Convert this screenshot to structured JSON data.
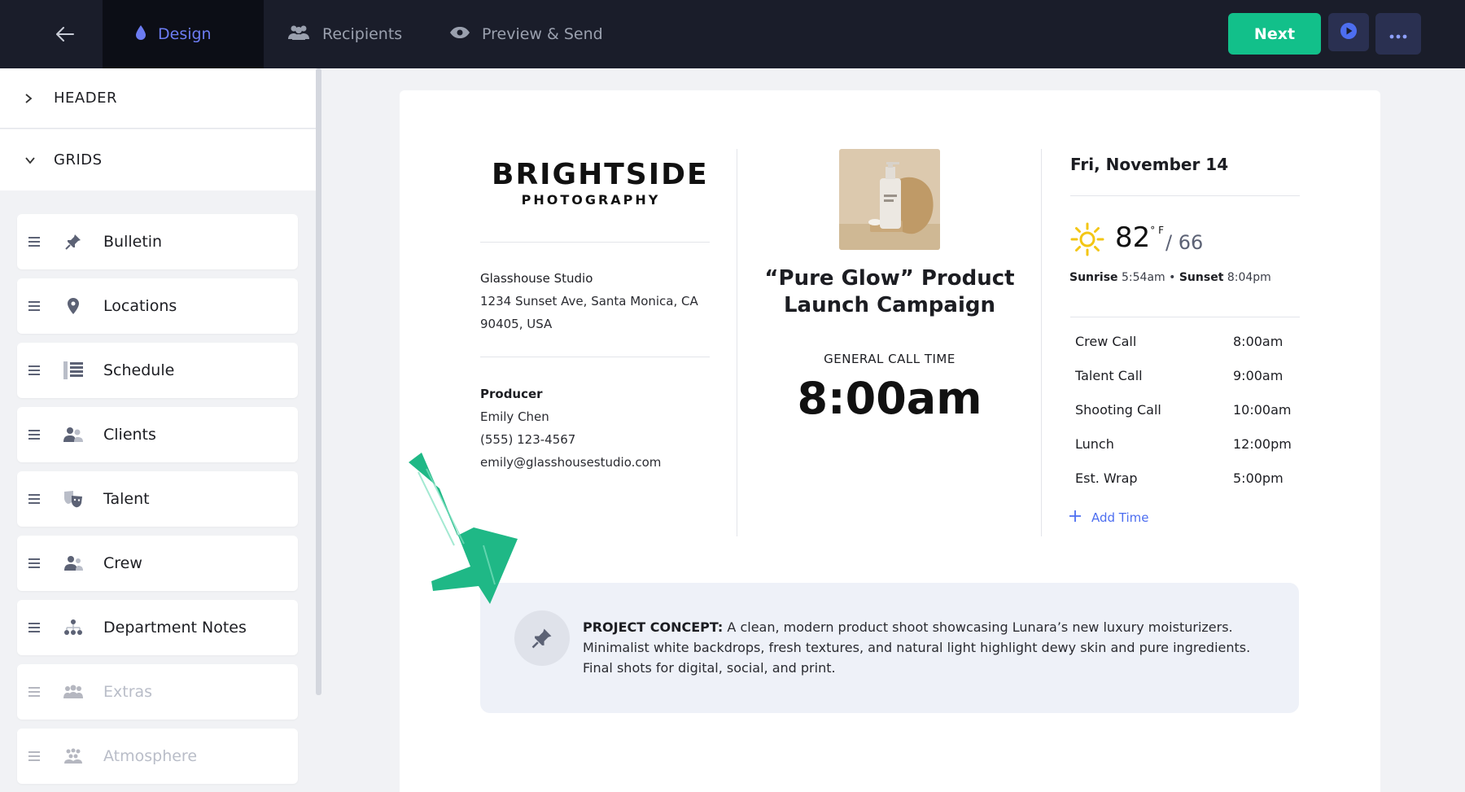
{
  "topbar": {
    "tabs": [
      {
        "label": "Design",
        "icon": "droplet-icon",
        "active": true
      },
      {
        "label": "Recipients",
        "icon": "people-icon",
        "active": false
      },
      {
        "label": "Preview & Send",
        "icon": "eye-icon",
        "active": false
      }
    ],
    "next_label": "Next"
  },
  "sidebar": {
    "header_label": "HEADER",
    "grids_label": "GRIDS",
    "items": [
      {
        "label": "Bulletin",
        "icon": "pin-icon",
        "enabled": true
      },
      {
        "label": "Locations",
        "icon": "map-pin-icon",
        "enabled": true
      },
      {
        "label": "Schedule",
        "icon": "list-icon",
        "enabled": true
      },
      {
        "label": "Clients",
        "icon": "clients-icon",
        "enabled": true
      },
      {
        "label": "Talent",
        "icon": "masks-icon",
        "enabled": true
      },
      {
        "label": "Crew",
        "icon": "crew-icon",
        "enabled": true
      },
      {
        "label": "Department Notes",
        "icon": "org-chart-icon",
        "enabled": true
      },
      {
        "label": "Extras",
        "icon": "group-icon",
        "enabled": false
      },
      {
        "label": "Atmosphere",
        "icon": "crowd-icon",
        "enabled": false
      }
    ]
  },
  "sheet": {
    "logo": {
      "main": "BRIGHTSIDE",
      "sub": "PHOTOGRAPHY"
    },
    "studio": {
      "name": "Glasshouse Studio",
      "address1": "1234 Sunset Ave, Santa Monica, CA",
      "address2": "90405, USA"
    },
    "producer": {
      "label": "Producer",
      "name": "Emily Chen",
      "phone": "(555) 123-4567",
      "email": "emily@glasshousestudio.com"
    },
    "title": "“Pure Glow” Product Launch Campaign",
    "general_call_label": "GENERAL CALL TIME",
    "general_call_time": "8:00am",
    "date": "Fri, November 14",
    "weather": {
      "high": "82",
      "unit": "° F",
      "low": "/ 66",
      "sunrise_label": "Sunrise",
      "sunrise": "5:54am",
      "separator": "•",
      "sunset_label": "Sunset",
      "sunset": "8:04pm"
    },
    "schedule": [
      {
        "label": "Crew Call",
        "time": "8:00am"
      },
      {
        "label": "Talent Call",
        "time": "9:00am"
      },
      {
        "label": "Shooting Call",
        "time": "10:00am"
      },
      {
        "label": "Lunch",
        "time": "12:00pm"
      },
      {
        "label": "Est. Wrap",
        "time": "5:00pm"
      }
    ],
    "add_time_label": "Add Time",
    "concept": {
      "label": "PROJECT CONCEPT:",
      "text": "A clean, modern product shoot showcasing Lunara’s new luxury moisturizers. Minimalist white backdrops, fresh textures, and natural light highlight dewy skin and pure ingredients. Final shots for digital, social, and print."
    }
  },
  "colors": {
    "topbar_bg": "#1a1d2a",
    "accent": "#6c7cf2",
    "next_button": "#12c08a",
    "arrow": "#1fb886"
  }
}
